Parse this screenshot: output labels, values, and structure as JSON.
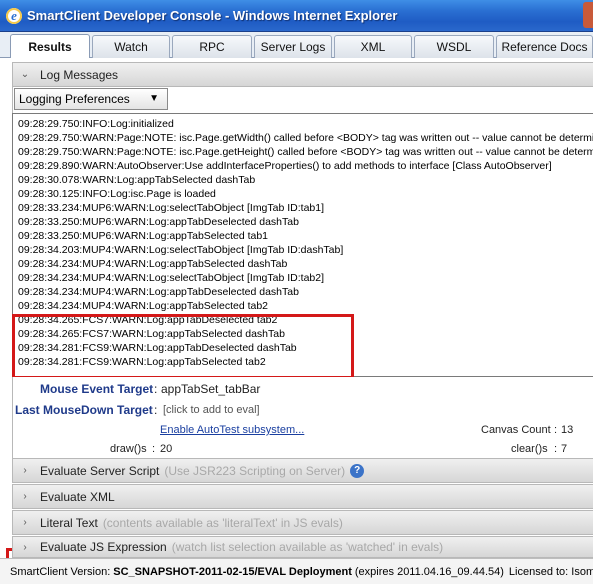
{
  "window": {
    "title": "SmartClient Developer Console - Windows Internet Explorer",
    "app_icon": "ie-icon"
  },
  "tabs": [
    {
      "label": "Results",
      "active": true
    },
    {
      "label": "Watch"
    },
    {
      "label": "RPC"
    },
    {
      "label": "Server Logs"
    },
    {
      "label": "XML"
    },
    {
      "label": "WSDL"
    },
    {
      "label": "Reference Docs"
    }
  ],
  "log_section": {
    "title": "Log Messages",
    "prefs_label": "Logging Preferences"
  },
  "log_lines": [
    "09:28:29.750:INFO:Log:initialized",
    "09:28:29.750:WARN:Page:NOTE: isc.Page.getWidth() called before <BODY> tag was written out -- value cannot be determined",
    "09:28:29.750:WARN:Page:NOTE: isc.Page.getHeight() called before <BODY> tag was written out -- value cannot be determined",
    "09:28:29.890:WARN:AutoObserver:Use addInterfaceProperties() to add methods to interface [Class AutoObserver]",
    "09:28:30.078:WARN:Log:appTabSelected dashTab",
    "09:28:30.125:INFO:Log:isc.Page is loaded",
    "09:28:33.234:MUP6:WARN:Log:selectTabObject [ImgTab ID:tab1]",
    "09:28:33.250:MUP6:WARN:Log:appTabDeselected dashTab",
    "09:28:33.250:MUP6:WARN:Log:appTabSelected tab1",
    "09:28:34.203:MUP4:WARN:Log:selectTabObject [ImgTab ID:dashTab]",
    "09:28:34.234:MUP4:WARN:Log:appTabSelected dashTab",
    "09:28:34.234:MUP4:WARN:Log:selectTabObject [ImgTab ID:tab2]",
    "09:28:34.234:MUP4:WARN:Log:appTabDeselected dashTab",
    "09:28:34.234:MUP4:WARN:Log:appTabSelected tab2",
    "09:28:34.265:FCS7:WARN:Log:appTabDeselected tab2",
    "09:28:34.265:FCS7:WARN:Log:appTabSelected dashTab",
    "09:28:34.281:FCS9:WARN:Log:appTabDeselected dashTab",
    "09:28:34.281:FCS9:WARN:Log:appTabSelected tab2"
  ],
  "inspector": {
    "mouse_event_label": "Mouse Event Target",
    "mouse_event_value": "appTabSet_tabBar",
    "last_mousedown_label": "Last MouseDown Target",
    "last_mousedown_value": "[click to add to eval]",
    "autotest_link": "Enable AutoTest subsystem...",
    "canvas_count_label": "Canvas Count",
    "canvas_count_value": "13",
    "draws_label": "draw()s",
    "draws_value": "20",
    "clears_label": "clear()s",
    "clears_value": "7"
  },
  "sections": [
    {
      "title": "Evaluate Server Script",
      "hint": "(Use JSR223 Scripting on Server)",
      "help": "?"
    },
    {
      "title": "Evaluate XML",
      "hint": ""
    },
    {
      "title": "Literal Text",
      "hint": "(contents available as 'literalText' in JS evals)"
    },
    {
      "title": "Evaluate JS Expression",
      "hint": "(watch list selection available as 'watched' in evals)"
    }
  ],
  "footer": {
    "prefix": "SmartClient Version:",
    "version": "SC_SNAPSHOT-2011-02-15/EVAL Deployment",
    "expires": "(expires 2011.04.16_09.44.54)",
    "license": "Licensed to: Isomorphic Software (#ISC_EVAL_NIGHTLY)"
  },
  "colors": {
    "highlight": "#d41818",
    "title_bar": "#2a6fd2",
    "label_blue": "#1f3a8a"
  }
}
